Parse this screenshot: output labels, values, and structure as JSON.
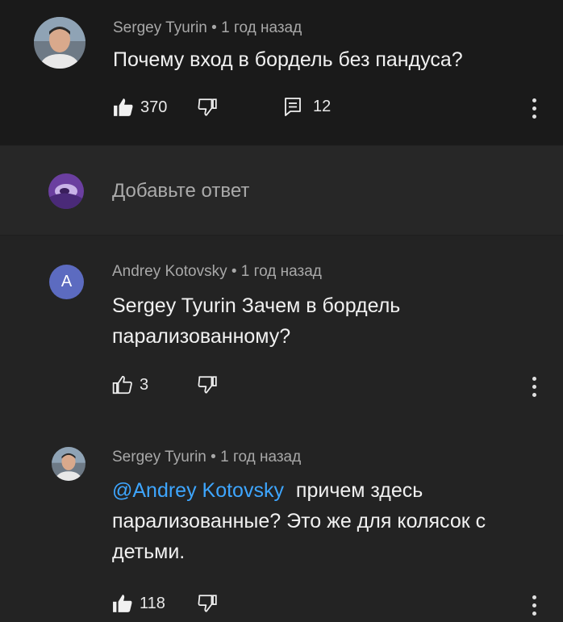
{
  "top_comment": {
    "author": "Sergey Tyurin",
    "separator": "•",
    "time": "1 год назад",
    "text": "Почему вход в бордель без пандуса?",
    "likes": "370",
    "replies": "12"
  },
  "reply_box": {
    "placeholder": "Добавьте ответ"
  },
  "reply1": {
    "avatar_letter": "A",
    "author": "Andrey Kotovsky",
    "separator": "•",
    "time": "1 год назад",
    "text_line1": "Sergey Tyurin Зачем в бордель",
    "text_line2": "парализованному?",
    "likes": "3"
  },
  "reply2": {
    "author": "Sergey Tyurin",
    "separator": "•",
    "time": "1 год назад",
    "mention": "@Andrey Kotovsky",
    "text_line1_rest": "причем здесь",
    "text_line2": "парализованные? Это же для колясок с",
    "text_line3": "детьми.",
    "likes": "118"
  },
  "colors": {
    "mention": "#3ea6ff",
    "avatar_letter_bg": "#5c6bc0"
  }
}
